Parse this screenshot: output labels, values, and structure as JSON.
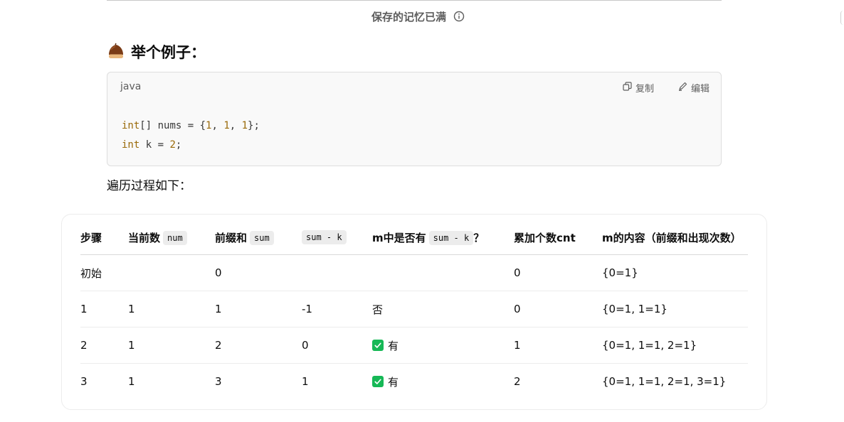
{
  "header": {
    "memory_notice": "保存的记忆已满",
    "info_icon": "info-circle-icon"
  },
  "section": {
    "heading": "举个例子：",
    "heading_icon": "chestnut-icon"
  },
  "code_block": {
    "language": "java",
    "copy_label": "复制",
    "edit_label": "编辑",
    "lines": [
      [
        {
          "t": "int",
          "c": "kw"
        },
        {
          "t": "[] nums = {",
          "c": ""
        },
        {
          "t": "1",
          "c": "num"
        },
        {
          "t": ", ",
          "c": ""
        },
        {
          "t": "1",
          "c": "num"
        },
        {
          "t": ", ",
          "c": ""
        },
        {
          "t": "1",
          "c": "num"
        },
        {
          "t": "};",
          "c": ""
        }
      ],
      [
        {
          "t": "int",
          "c": "kw"
        },
        {
          "t": " k = ",
          "c": ""
        },
        {
          "t": "2",
          "c": "num"
        },
        {
          "t": ";",
          "c": ""
        }
      ]
    ],
    "colors": {
      "keyword": "#9a6a0a",
      "number": "#9a6a0a",
      "text": "#383838"
    }
  },
  "intro": "遍历过程如下：",
  "table": {
    "headers": [
      {
        "text": "步骤",
        "code": ""
      },
      {
        "text": "当前数",
        "code": "num"
      },
      {
        "text": "前缀和",
        "code": "sum"
      },
      {
        "text": "",
        "code": "sum - k"
      },
      {
        "text": "m中是否有",
        "code": "sum - k",
        "suffix": "？"
      },
      {
        "text": "累加个数cnt",
        "code": ""
      },
      {
        "text": "m的内容（前缀和出现次数）",
        "code": ""
      }
    ],
    "rows": [
      [
        "初始",
        "",
        "0",
        "",
        "",
        "0",
        "{0=1}"
      ],
      [
        "1",
        "1",
        "1",
        "-1",
        "否",
        "0",
        "{0=1, 1=1}"
      ],
      [
        "2",
        "1",
        "2",
        "0",
        "✅ 有",
        "1",
        "{0=1, 1=1, 2=1}"
      ],
      [
        "3",
        "1",
        "3",
        "1",
        "✅ 有",
        "2",
        "{0=1, 1=1, 2=1, 3=1}"
      ]
    ],
    "check_color": "#16b856"
  }
}
